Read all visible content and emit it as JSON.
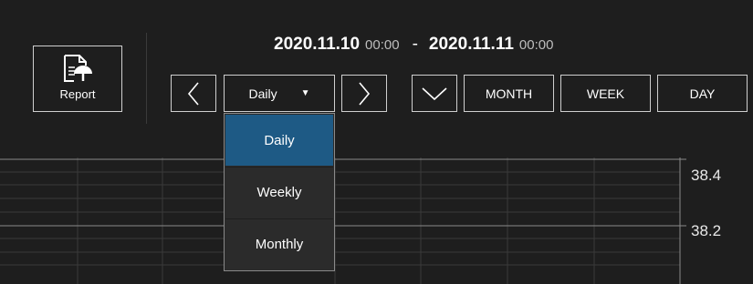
{
  "report": {
    "label": "Report"
  },
  "date_range": {
    "start_date": "2020.11.10",
    "start_time": "00:00",
    "separator": "-",
    "end_date": "2020.11.11",
    "end_time": "00:00"
  },
  "period_select": {
    "value": "Daily"
  },
  "buttons": {
    "month": "MONTH",
    "week": "WEEK",
    "day": "DAY"
  },
  "dropdown": {
    "options": [
      {
        "label": "Daily",
        "selected": true
      },
      {
        "label": "Weekly",
        "selected": false
      },
      {
        "label": "Monthly",
        "selected": false
      }
    ]
  },
  "chart": {
    "y_ticks": [
      "38.4",
      "38.2"
    ]
  },
  "colors": {
    "background": "#1e1e1e",
    "selected": "#1e5a85",
    "border": "#cfcfcf"
  }
}
